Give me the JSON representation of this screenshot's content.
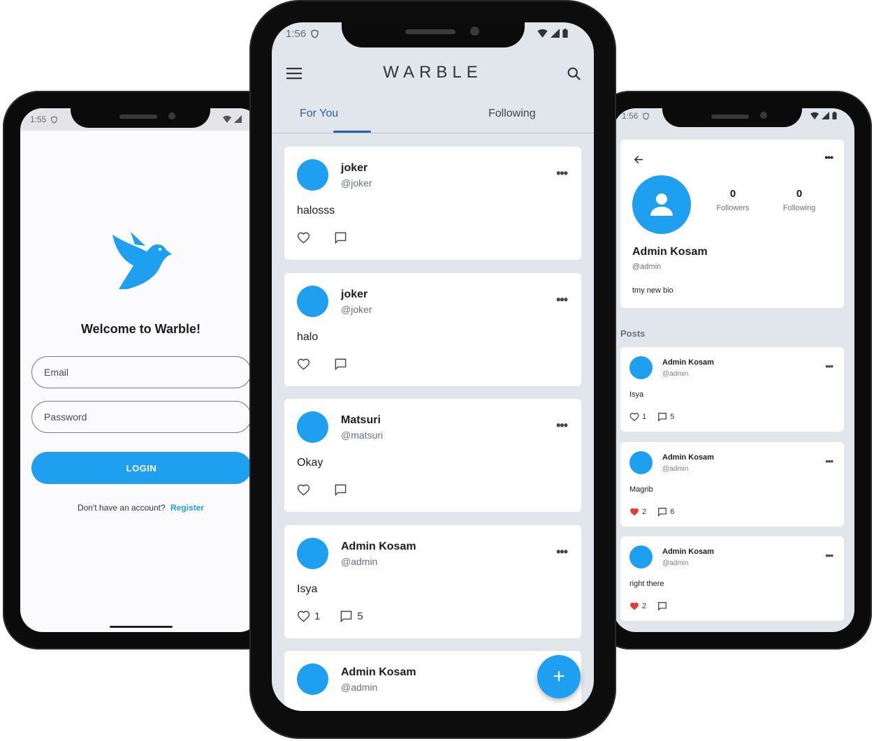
{
  "colors": {
    "accent": "#1f9ff0",
    "screen_bg": "#e1e6ec",
    "heart_liked": "#e53935"
  },
  "login_screen": {
    "status": {
      "time": "1:55"
    },
    "welcome": "Welcome to Warble!",
    "email_placeholder": "Email",
    "password_placeholder": "Password",
    "login_label": "LOGIN",
    "no_account_text": "Don't have an account?",
    "register_label": "Register"
  },
  "feed_screen": {
    "status": {
      "time": "1:56"
    },
    "app_title": "WARBLE",
    "tabs": [
      {
        "label": "For You",
        "active": true
      },
      {
        "label": "Following",
        "active": false
      }
    ],
    "posts": [
      {
        "name": "joker",
        "handle": "@joker",
        "text": "halosss",
        "likes": "",
        "comments": ""
      },
      {
        "name": "joker",
        "handle": "@joker",
        "text": "halo",
        "likes": "",
        "comments": ""
      },
      {
        "name": "Matsuri",
        "handle": "@matsuri",
        "text": "Okay",
        "likes": "",
        "comments": ""
      },
      {
        "name": "Admin Kosam",
        "handle": "@admin",
        "text": "Isya",
        "likes": "1",
        "comments": "5"
      },
      {
        "name": "Admin Kosam",
        "handle": "@admin",
        "text": "",
        "likes": "",
        "comments": ""
      }
    ],
    "fab_label": "+"
  },
  "profile_screen": {
    "status": {
      "time": "1:56"
    },
    "followers_count": "0",
    "followers_label": "Followers",
    "following_count": "0",
    "following_label": "Following",
    "name": "Admin Kosam",
    "handle": "@admin",
    "bio": "tmy new bio",
    "posts_heading": "Posts",
    "posts": [
      {
        "name": "Admin Kosam",
        "handle": "@admin",
        "text": "Isya",
        "likes": "1",
        "comments": "5",
        "liked": false
      },
      {
        "name": "Admin Kosam",
        "handle": "@admin",
        "text": "Magrib",
        "likes": "2",
        "comments": "6",
        "liked": true
      },
      {
        "name": "Admin Kosam",
        "handle": "@admin",
        "text": "right there",
        "likes": "2",
        "comments": "",
        "liked": true
      }
    ]
  }
}
